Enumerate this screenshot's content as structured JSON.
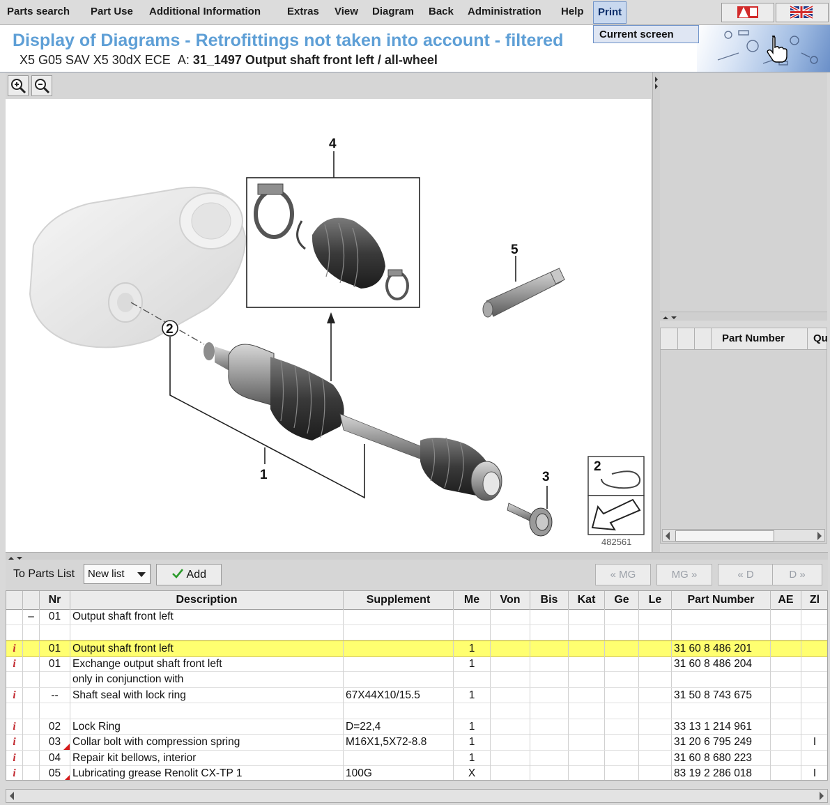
{
  "menu": {
    "items": [
      "Parts search",
      "Part Use",
      "Additional Information",
      "Extras",
      "View",
      "Diagram",
      "Back",
      "Administration",
      "Help"
    ],
    "print": "Print",
    "dropdown_item": "Current screen"
  },
  "header": {
    "title": "Display of Diagrams - Retrofittings not taken into account - filtered",
    "vehicle": "X5 G05 SAV X5 30dX ECE",
    "assembly_prefix": "A:",
    "assembly": "31_1497 Output shaft front left / all-wheel"
  },
  "diagram": {
    "callouts": [
      "1",
      "2",
      "3",
      "4",
      "5"
    ],
    "inset_number": "2",
    "image_number": "482561"
  },
  "right_panel": {
    "columns": [
      "Part Number",
      "Qu"
    ]
  },
  "parts_toolbar": {
    "label": "To Parts List",
    "list_select": "New list",
    "add_label": "Add",
    "nav": [
      "« MG",
      "MG »",
      "« D",
      "D »"
    ]
  },
  "table": {
    "columns": [
      "Nr",
      "Description",
      "Supplement",
      "Me",
      "Von",
      "Bis",
      "Kat",
      "Ge",
      "Le",
      "Part Number",
      "AE",
      "Zl"
    ],
    "rows": [
      {
        "info": "",
        "tree": "–",
        "nr": "01",
        "desc": "Output shaft front left",
        "supp": "",
        "me": "",
        "part": "",
        "zl": "",
        "highlight": false,
        "flag": false
      },
      {
        "info": "",
        "tree": "",
        "nr": "",
        "desc": "",
        "supp": "",
        "me": "",
        "part": "",
        "zl": "",
        "highlight": false,
        "flag": false
      },
      {
        "info": "i",
        "tree": "",
        "nr": "01",
        "desc": "Output shaft front left",
        "supp": "",
        "me": "1",
        "part": "31 60 8 486 201",
        "zl": "",
        "highlight": true,
        "flag": false
      },
      {
        "info": "i",
        "tree": "",
        "nr": "01",
        "desc": "Exchange output shaft front left",
        "supp": "",
        "me": "1",
        "part": "31 60 8 486 204",
        "zl": "",
        "highlight": false,
        "flag": false
      },
      {
        "info": "",
        "tree": "",
        "nr": "",
        "desc": "only in conjunction with",
        "supp": "",
        "me": "",
        "part": "",
        "zl": "",
        "highlight": false,
        "flag": false
      },
      {
        "info": "i",
        "tree": "",
        "nr": "--",
        "desc": "Shaft seal with lock ring",
        "supp": "67X44X10/15.5",
        "me": "1",
        "part": "31 50 8 743 675",
        "zl": "",
        "highlight": false,
        "flag": false
      },
      {
        "info": "",
        "tree": "",
        "nr": "",
        "desc": "",
        "supp": "",
        "me": "",
        "part": "",
        "zl": "",
        "highlight": false,
        "flag": false
      },
      {
        "info": "i",
        "tree": "",
        "nr": "02",
        "desc": "Lock Ring",
        "supp": "D=22,4",
        "me": "1",
        "part": "33 13 1 214 961",
        "zl": "",
        "highlight": false,
        "flag": false
      },
      {
        "info": "i",
        "tree": "",
        "nr": "03",
        "desc": "Collar bolt with compression spring",
        "supp": "M16X1,5X72-8.8",
        "me": "1",
        "part": "31 20 6 795 249",
        "zl": "I",
        "highlight": false,
        "flag": true
      },
      {
        "info": "i",
        "tree": "",
        "nr": "04",
        "desc": "Repair kit bellows, interior",
        "supp": "",
        "me": "1",
        "part": "31 60 8 680 223",
        "zl": "",
        "highlight": false,
        "flag": false
      },
      {
        "info": "i",
        "tree": "",
        "nr": "05",
        "desc": "Lubricating grease Renolit CX-TP 1",
        "supp": "100G",
        "me": "X",
        "part": "83 19 2 286 018",
        "zl": "I",
        "highlight": false,
        "flag": true
      }
    ]
  },
  "colors": {
    "title_blue": "#5e9fd6",
    "highlight_row": "#ffff70",
    "info_red": "#c1272d",
    "check_green": "#2a9a2a"
  }
}
